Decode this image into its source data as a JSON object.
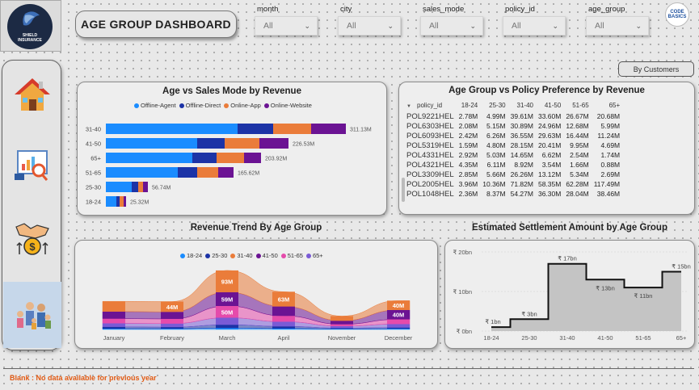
{
  "logo": {
    "line1": "SHIELD",
    "line2": "INSURANCE"
  },
  "nav": [
    {
      "name": "home"
    },
    {
      "name": "analytics"
    },
    {
      "name": "settlement"
    },
    {
      "name": "age-group"
    }
  ],
  "header": {
    "title": "AGE GROUP DASHBOARD"
  },
  "slicers": [
    {
      "label": "month",
      "value": "All"
    },
    {
      "label": "city",
      "value": "All"
    },
    {
      "label": "sales_mode",
      "value": "All"
    },
    {
      "label": "policy_id",
      "value": "All"
    },
    {
      "label": "age_group",
      "value": "All"
    }
  ],
  "brand": {
    "line1": "CODE",
    "line2": "BASICS"
  },
  "toggle": {
    "label": "By Customers"
  },
  "colors": {
    "offline_agent": "#1a8cff",
    "offline_direct": "#1c33a6",
    "online_app": "#ea7c3a",
    "online_website": "#6b1393",
    "age_18_24": "#1a8cff",
    "age_25_30": "#1c33a6",
    "age_31_40": "#ea7c3a",
    "age_41_50": "#6b1393",
    "age_51_65": "#e54bab",
    "age_65p": "#7a5bd6"
  },
  "chart1": {
    "title": "Age vs Sales Mode by Revenue",
    "legend": [
      "Offline-Agent",
      "Offline-Direct",
      "Online-App",
      "Online-Website"
    ]
  },
  "chart2": {
    "title": "Age Group vs Policy Preference by Revenue",
    "columns": [
      "policy_id",
      "18-24",
      "25-30",
      "31-40",
      "41-50",
      "51-65",
      "65+"
    ],
    "rows": [
      [
        "POL9221HEL",
        "2.78M",
        "4.99M",
        "39.61M",
        "33.60M",
        "26.67M",
        "20.68M"
      ],
      [
        "POL6303HEL",
        "2.08M",
        "5.15M",
        "30.89M",
        "24.96M",
        "12.68M",
        "5.99M"
      ],
      [
        "POL6093HEL",
        "2.42M",
        "6.26M",
        "36.55M",
        "29.63M",
        "16.44M",
        "11.24M"
      ],
      [
        "POL5319HEL",
        "1.59M",
        "4.80M",
        "28.15M",
        "20.41M",
        "9.95M",
        "4.69M"
      ],
      [
        "POL4331HEL",
        "2.92M",
        "5.03M",
        "14.65M",
        "6.62M",
        "2.54M",
        "1.74M"
      ],
      [
        "POL4321HEL",
        "4.35M",
        "6.11M",
        "8.92M",
        "3.54M",
        "1.66M",
        "0.88M"
      ],
      [
        "POL3309HEL",
        "2.85M",
        "5.66M",
        "26.26M",
        "13.12M",
        "5.34M",
        "2.69M"
      ],
      [
        "POL2005HEL",
        "3.96M",
        "10.36M",
        "71.82M",
        "58.35M",
        "62.28M",
        "117.49M"
      ],
      [
        "POL1048HEL",
        "2.36M",
        "8.37M",
        "54.27M",
        "36.30M",
        "28.04M",
        "38.46M"
      ]
    ]
  },
  "chart3": {
    "title": "Revenue Trend By Age Group",
    "legend": [
      "18-24",
      "25-30",
      "31-40",
      "41-50",
      "51-65",
      "65+"
    ]
  },
  "chart4": {
    "title": "Estimated Settlement Amount by Age Group"
  },
  "footer": {
    "note": "Blank : No data available for previous year"
  },
  "chart_data": [
    {
      "type": "bar",
      "orientation": "horizontal",
      "stacked": true,
      "title": "Age vs Sales Mode by Revenue",
      "categories": [
        "31-40",
        "41-50",
        "65+",
        "51-65",
        "25-30",
        "18-24"
      ],
      "totals_labels": [
        "311.13M",
        "226.53M",
        "203.92M",
        "165.62M",
        "56.74M",
        "25.32M"
      ],
      "series": [
        {
          "name": "Offline-Agent",
          "values": [
            163,
            113,
            107,
            89,
            32,
            13
          ]
        },
        {
          "name": "Offline-Direct",
          "values": [
            44,
            34,
            30,
            24,
            8,
            4
          ]
        },
        {
          "name": "Online-App",
          "values": [
            47,
            43,
            34,
            26,
            6,
            5
          ]
        },
        {
          "name": "Online-Website",
          "values": [
            43,
            36,
            21,
            19,
            6,
            3
          ]
        }
      ],
      "legend_position": "top"
    },
    {
      "type": "area",
      "stacked": true,
      "title": "Revenue Trend By Age Group",
      "x": [
        "January",
        "February",
        "March",
        "April",
        "November",
        "December"
      ],
      "series": [
        {
          "name": "18-24",
          "values": [
            3,
            3,
            6,
            4,
            2,
            3
          ]
        },
        {
          "name": "25-30",
          "values": [
            8,
            7,
            14,
            9,
            4,
            5
          ]
        },
        {
          "name": "31-40",
          "values": [
            44,
            44,
            93,
            63,
            20,
            40
          ]
        },
        {
          "name": "41-50",
          "values": [
            30,
            30,
            59,
            40,
            15,
            40
          ]
        },
        {
          "name": "51-65",
          "values": [
            20,
            20,
            50,
            25,
            8,
            20
          ]
        },
        {
          "name": "65+",
          "values": [
            15,
            15,
            30,
            20,
            8,
            15
          ]
        }
      ],
      "data_labels": [
        {
          "x": "February",
          "text": "44M"
        },
        {
          "x": "March",
          "text": "93M"
        },
        {
          "x": "March",
          "text": "59M"
        },
        {
          "x": "March",
          "text": "50M"
        },
        {
          "x": "April",
          "text": "63M"
        },
        {
          "x": "December",
          "text": "40M"
        },
        {
          "x": "December",
          "text": "40M"
        }
      ],
      "legend_position": "top"
    },
    {
      "type": "area",
      "step": true,
      "title": "Estimated Settlement Amount by Age Group",
      "categories": [
        "18-24",
        "25-30",
        "31-40",
        "41-50",
        "51-65",
        "65+"
      ],
      "values": [
        1,
        3,
        17,
        13,
        11,
        15
      ],
      "value_labels": [
        "₹ 1bn",
        "₹ 3bn",
        "₹ 17bn",
        "₹ 13bn",
        "₹ 11bn",
        "₹ 15bn"
      ],
      "y_ticks": [
        "₹ 0bn",
        "₹ 10bn",
        "₹ 20bn"
      ],
      "ylim": [
        0,
        20
      ]
    }
  ]
}
